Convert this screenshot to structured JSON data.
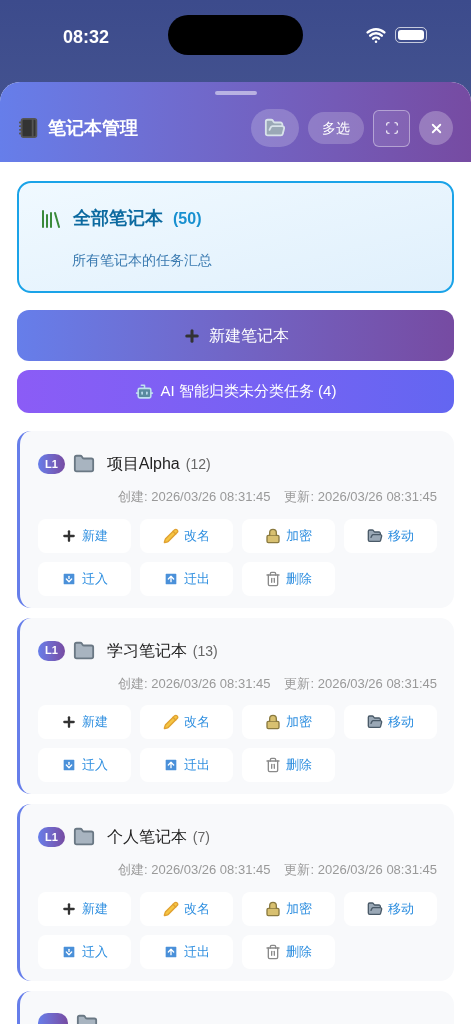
{
  "status_bar": {
    "time": "08:32"
  },
  "header": {
    "title": "笔记本管理",
    "buttons": [
      {
        "kind": "folder"
      },
      {
        "kind": "text",
        "label": "多选"
      },
      {
        "kind": "fullscreen"
      },
      {
        "kind": "close"
      }
    ]
  },
  "all_notebooks": {
    "title": "全部笔记本",
    "count": "(50)",
    "subtitle": "所有笔记本的任务汇总",
    "selected": true
  },
  "new_button": {
    "label": "新建笔记本"
  },
  "ai_button": {
    "label": "AI 智能归类未分类任务 (4)"
  },
  "notebooks": [
    {
      "level": "L1",
      "name": "项目Alpha",
      "count": "(12)",
      "created": "创建: 2026/03/26 08:31:45",
      "updated": "更新: 2026/03/26 08:31:45",
      "actions": [
        {
          "kind": "new",
          "label": "新建"
        },
        {
          "kind": "rename",
          "label": "改名"
        },
        {
          "kind": "lock",
          "label": "加密"
        },
        {
          "kind": "move",
          "label": "移动"
        },
        {
          "kind": "import",
          "label": "迁入"
        },
        {
          "kind": "export",
          "label": "迁出"
        },
        {
          "kind": "delete",
          "label": "删除"
        }
      ]
    },
    {
      "level": "L1",
      "name": "学习笔记本",
      "count": "(13)",
      "created": "创建: 2026/03/26 08:31:45",
      "updated": "更新: 2026/03/26 08:31:45",
      "actions": [
        {
          "kind": "new",
          "label": "新建"
        },
        {
          "kind": "rename",
          "label": "改名"
        },
        {
          "kind": "lock",
          "label": "加密"
        },
        {
          "kind": "move",
          "label": "移动"
        },
        {
          "kind": "import",
          "label": "迁入"
        },
        {
          "kind": "export",
          "label": "迁出"
        },
        {
          "kind": "delete",
          "label": "删除"
        }
      ]
    },
    {
      "level": "L1",
      "name": "个人笔记本",
      "count": "(7)",
      "created": "创建: 2026/03/26 08:31:45",
      "updated": "更新: 2026/03/26 08:31:45",
      "actions": [
        {
          "kind": "new",
          "label": "新建"
        },
        {
          "kind": "rename",
          "label": "改名"
        },
        {
          "kind": "lock",
          "label": "加密"
        },
        {
          "kind": "move",
          "label": "移动"
        },
        {
          "kind": "import",
          "label": "迁入"
        },
        {
          "kind": "export",
          "label": "迁出"
        },
        {
          "kind": "delete",
          "label": "删除"
        }
      ]
    }
  ],
  "more_below": true
}
